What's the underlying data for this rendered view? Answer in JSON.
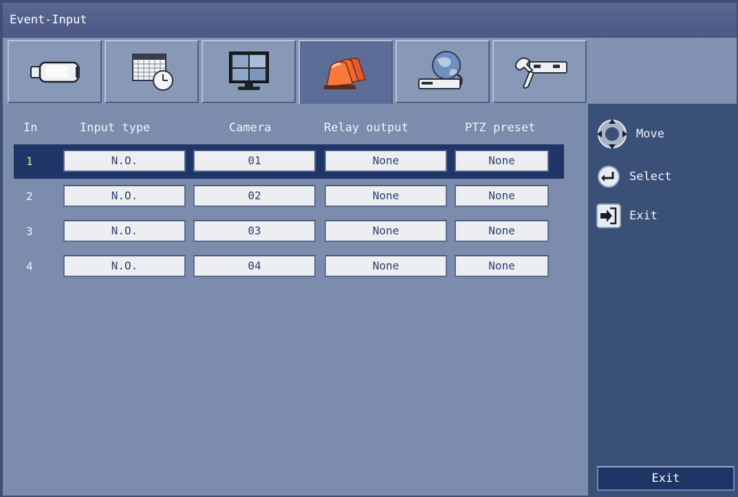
{
  "window": {
    "title": "Event-Input"
  },
  "tabs": [
    {
      "icon": "camera-icon"
    },
    {
      "icon": "schedule-icon"
    },
    {
      "icon": "monitor-icon"
    },
    {
      "icon": "alarm-icon",
      "active": true
    },
    {
      "icon": "network-icon"
    },
    {
      "icon": "tools-icon"
    }
  ],
  "table": {
    "headers": {
      "in": "In",
      "input_type": "Input type",
      "camera": "Camera",
      "relay": "Relay output",
      "ptz": "PTZ preset"
    },
    "rows": [
      {
        "in": "1",
        "input_type": "N.O.",
        "camera": "01",
        "relay": "None",
        "ptz": "None",
        "selected": true
      },
      {
        "in": "2",
        "input_type": "N.O.",
        "camera": "02",
        "relay": "None",
        "ptz": "None"
      },
      {
        "in": "3",
        "input_type": "N.O.",
        "camera": "03",
        "relay": "None",
        "ptz": "None"
      },
      {
        "in": "4",
        "input_type": "N.O.",
        "camera": "04",
        "relay": "None",
        "ptz": "None"
      }
    ]
  },
  "legend": {
    "move": "Move",
    "select": "Select",
    "exit": "Exit"
  },
  "exit_button": "Exit",
  "colors": {
    "selected_row": "#1f3568",
    "accent_alarm": "#e8502a",
    "selected_number": "#f6e56a"
  }
}
